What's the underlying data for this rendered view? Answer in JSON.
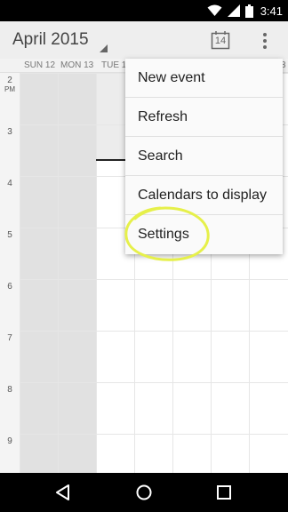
{
  "status_bar": {
    "time": "3:41",
    "icons": [
      "wifi-icon",
      "signal-icon",
      "battery-icon"
    ]
  },
  "app_bar": {
    "title": "April 2015",
    "today_date": "14",
    "icons": [
      "dropdown-triangle-icon",
      "calendar-today-icon",
      "overflow-menu-icon"
    ]
  },
  "day_headers": [
    "SUN 12",
    "MON 13",
    "TUE 1"
  ],
  "day_header_partial_right": "3",
  "hours": [
    {
      "num": "2",
      "suffix": "PM"
    },
    {
      "num": "3",
      "suffix": ""
    },
    {
      "num": "4",
      "suffix": ""
    },
    {
      "num": "5",
      "suffix": ""
    },
    {
      "num": "6",
      "suffix": ""
    },
    {
      "num": "7",
      "suffix": ""
    },
    {
      "num": "8",
      "suffix": ""
    },
    {
      "num": "9",
      "suffix": ""
    }
  ],
  "menu": {
    "items": [
      "New event",
      "Refresh",
      "Search",
      "Calendars to display",
      "Settings"
    ],
    "highlighted_item": "Settings",
    "highlight_color": "#e6f04a"
  },
  "nav_bar": {
    "icons": [
      "back-icon",
      "home-icon",
      "recents-icon"
    ]
  },
  "colors": {
    "status_bar": "#000000",
    "app_bar": "#eeeeee",
    "weekend_shade": "#e1e1e1"
  }
}
